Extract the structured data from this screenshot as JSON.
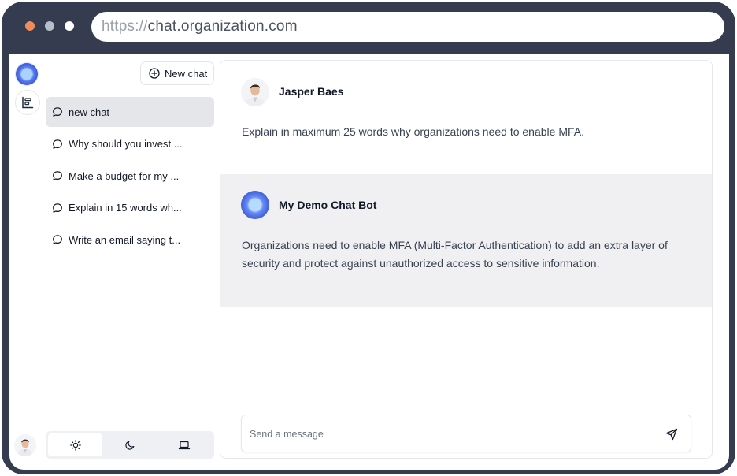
{
  "browser": {
    "url_scheme": "https://",
    "url_host": "chat.organization.com"
  },
  "sidebar": {
    "new_chat_label": "New chat",
    "conversations": [
      {
        "label": "new chat",
        "active": true
      },
      {
        "label": "Why should you invest ...",
        "active": false
      },
      {
        "label": "Make a budget for my ...",
        "active": false
      },
      {
        "label": "Explain in 15 words wh...",
        "active": false
      },
      {
        "label": "Write an email saying t...",
        "active": false
      }
    ],
    "theme_options": [
      "light",
      "dark",
      "system"
    ],
    "theme_selected": "light"
  },
  "messages": [
    {
      "sender": "Jasper Baes",
      "role": "user",
      "text": "Explain in maximum 25 words why organizations need to enable MFA."
    },
    {
      "sender": "My Demo Chat Bot",
      "role": "assistant",
      "text": "Organizations need to enable MFA (Multi-Factor Authentication) to add an extra layer of security and protect against unauthorized access to sensitive information."
    }
  ],
  "composer": {
    "placeholder": "Send a message",
    "value": ""
  },
  "colors": {
    "frame": "#353c4f",
    "active_item_bg": "#e5e6ea",
    "bot_message_bg": "#f0f0f2",
    "brand_blue": "#3b59d6"
  }
}
